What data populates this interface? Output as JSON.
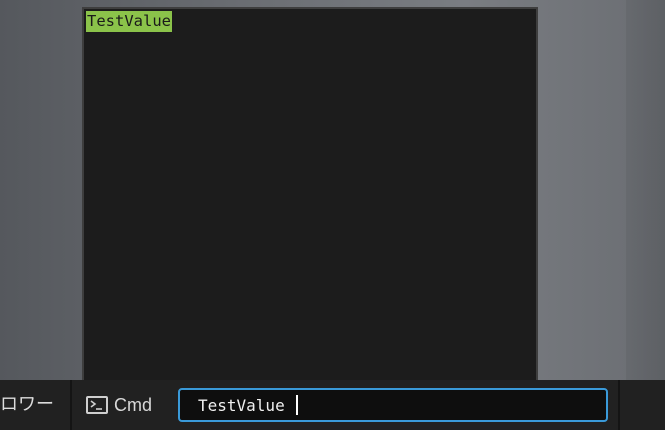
{
  "output": {
    "lines": [
      "TestValue"
    ]
  },
  "taskbar": {
    "left_label": "ロワー",
    "cmd_label": "Cmd",
    "cmd_icon": "terminal-icon",
    "input_value": "TestValue"
  },
  "colors": {
    "highlight": "#8bc34a",
    "input_border": "#3a9ad9",
    "panel_bg": "#1c1c1c",
    "taskbar_bg": "#212121"
  }
}
